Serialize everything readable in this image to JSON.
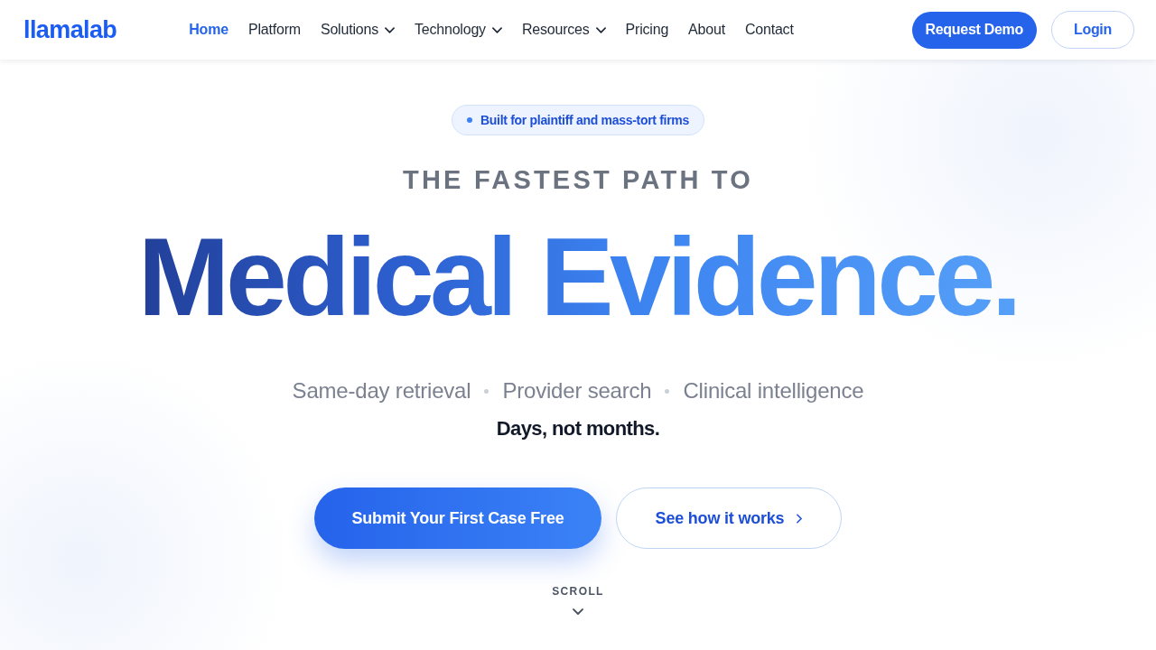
{
  "nav": {
    "logo": "llamalab",
    "links": [
      {
        "label": "Home",
        "selected": true,
        "has_menu": false
      },
      {
        "label": "Platform",
        "selected": false,
        "has_menu": false
      },
      {
        "label": "Solutions",
        "selected": false,
        "has_menu": true
      },
      {
        "label": "Technology",
        "selected": false,
        "has_menu": true
      },
      {
        "label": "Resources",
        "selected": false,
        "has_menu": true
      },
      {
        "label": "Pricing",
        "selected": false,
        "has_menu": false
      },
      {
        "label": "About",
        "selected": false,
        "has_menu": false
      },
      {
        "label": "Contact",
        "selected": false,
        "has_menu": false
      }
    ],
    "buttons": [
      {
        "label": "Request Demo",
        "kind": "primary"
      },
      {
        "label": "Login",
        "kind": "outline"
      }
    ]
  },
  "hero": {
    "badge": "Built for plaintiff and mass-tort firms",
    "eyebrow": "THE FASTEST PATH TO",
    "headline": "Medical Evidence.",
    "features": [
      "Same-day retrieval",
      "Provider search",
      "Clinical intelligence"
    ],
    "tagline": "Days, not months.",
    "actions": [
      {
        "label": "Submit Your First Case Free",
        "kind": "primary"
      },
      {
        "label": "See how it works",
        "kind": "secondary"
      }
    ],
    "scroll": "SCROLL"
  }
}
